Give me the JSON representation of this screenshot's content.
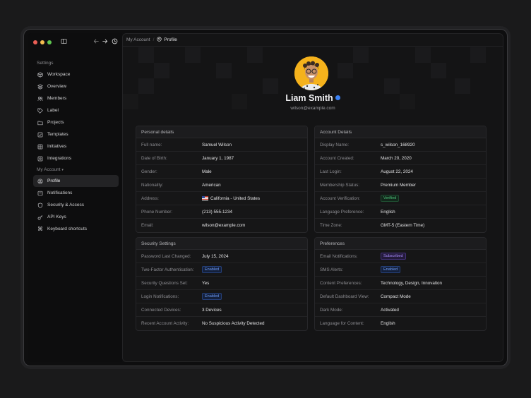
{
  "sidebar": {
    "settings_label": "Settings",
    "settings_items": [
      {
        "label": "Workspace",
        "icon": "cube-icon"
      },
      {
        "label": "Overview",
        "icon": "layers-icon"
      },
      {
        "label": "Members",
        "icon": "users-icon"
      },
      {
        "label": "Label",
        "icon": "tag-icon"
      },
      {
        "label": "Projects",
        "icon": "folder-icon"
      },
      {
        "label": "Templates",
        "icon": "template-icon"
      },
      {
        "label": "Initiatives",
        "icon": "grid-icon"
      },
      {
        "label": "Integrations",
        "icon": "plug-icon"
      }
    ],
    "account_label": "My Account",
    "account_items": [
      {
        "label": "Profile",
        "icon": "user-circle-icon",
        "active": true
      },
      {
        "label": "Notifications",
        "icon": "bell-icon"
      },
      {
        "label": "Security & Access",
        "icon": "shield-icon"
      },
      {
        "label": "API Keys",
        "icon": "key-icon"
      },
      {
        "label": "Keyboard shortcuts",
        "icon": "command-icon"
      }
    ]
  },
  "breadcrumb": {
    "parent": "My Account",
    "separator": "/",
    "current": "Profile"
  },
  "profile": {
    "name": "Liam Smith",
    "email": "wilson@example.com"
  },
  "cards": {
    "personal": {
      "title": "Personal details",
      "rows": [
        {
          "k": "Full name:",
          "v": "Samuel Wilson"
        },
        {
          "k": "Date of Birth:",
          "v": "January 1, 1987"
        },
        {
          "k": "Gender:",
          "v": "Male"
        },
        {
          "k": "Nationality:",
          "v": "American"
        },
        {
          "k": "Address:",
          "v": "California - United States"
        },
        {
          "k": "Phone Number:",
          "v": "(213) 555-1234"
        },
        {
          "k": "Email:",
          "v": "wilson@example.com"
        }
      ]
    },
    "account": {
      "title": "Account Details",
      "rows": [
        {
          "k": "Display Name:",
          "v": "s_wilson_168920"
        },
        {
          "k": "Account Created:",
          "v": "March 20, 2020"
        },
        {
          "k": "Last Login:",
          "v": "August 22, 2024"
        },
        {
          "k": "Membership Status:",
          "v": "Premium Member"
        },
        {
          "k": "Account Verification:",
          "v": "Verified"
        },
        {
          "k": "Language Preference:",
          "v": "English"
        },
        {
          "k": "Time Zone:",
          "v": "GMT-5 (Eastern Time)"
        }
      ]
    },
    "security": {
      "title": "Security Settings",
      "rows": [
        {
          "k": "Password Last Changed:",
          "v": "July 15, 2024"
        },
        {
          "k": "Two-Factor Authentication:",
          "v": "Enabled"
        },
        {
          "k": "Security Questions Set:",
          "v": "Yes"
        },
        {
          "k": "Login Notifications:",
          "v": "Enabled"
        },
        {
          "k": "Connected Devices:",
          "v": "3 Devices"
        },
        {
          "k": "Recent Account Activity:",
          "v": "No Suspicious Activity Detected"
        }
      ]
    },
    "preferences": {
      "title": "Preferences",
      "rows": [
        {
          "k": "Email Notifications:",
          "v": "Subscribed"
        },
        {
          "k": "SMS Alerts:",
          "v": "Enabled"
        },
        {
          "k": "Content Preferences:",
          "v": "Technology, Design, Innovation"
        },
        {
          "k": "Default Dashboard View:",
          "v": "Compact Mode"
        },
        {
          "k": "Dark Mode:",
          "v": "Activated"
        },
        {
          "k": "Language for Content:",
          "v": "English"
        }
      ]
    }
  },
  "colors": {
    "accent": "#3b82f6",
    "avatar_bg": "#f5b21c",
    "verified_green": "#4fc27a",
    "subscribed_purple": "#a78bfa"
  }
}
